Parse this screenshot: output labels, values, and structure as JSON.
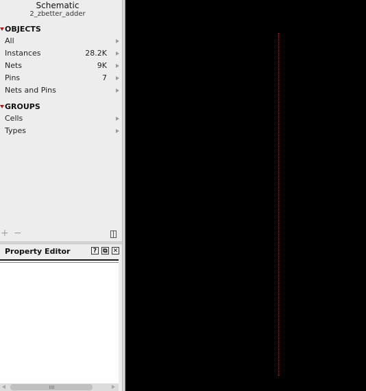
{
  "header": {
    "title": "Schematic",
    "subtitle": "2_zbetter_adder"
  },
  "objects": {
    "heading": "OBJECTS",
    "items": [
      {
        "label": "All",
        "count": ""
      },
      {
        "label": "Instances",
        "count": "28.2K"
      },
      {
        "label": "Nets",
        "count": "9K"
      },
      {
        "label": "Pins",
        "count": "7"
      },
      {
        "label": "Nets and Pins",
        "count": ""
      }
    ]
  },
  "groups": {
    "heading": "GROUPS",
    "items": [
      {
        "label": "Cells"
      },
      {
        "label": "Types"
      }
    ]
  },
  "toolbar": {
    "add_label": "+",
    "remove_label": "−",
    "add_icon": "plus-icon",
    "remove_icon": "minus-icon",
    "layout_icon": "panel-layout-icon"
  },
  "property_editor": {
    "title": "Property Editor",
    "help_label": "?",
    "float_label": "⧉",
    "close_label": "✕"
  },
  "colors": {
    "canvas_background": "#000000",
    "panel_background": "#ededed",
    "accent_triangle": "#b01818",
    "canvas_line": "#c81e1e"
  }
}
